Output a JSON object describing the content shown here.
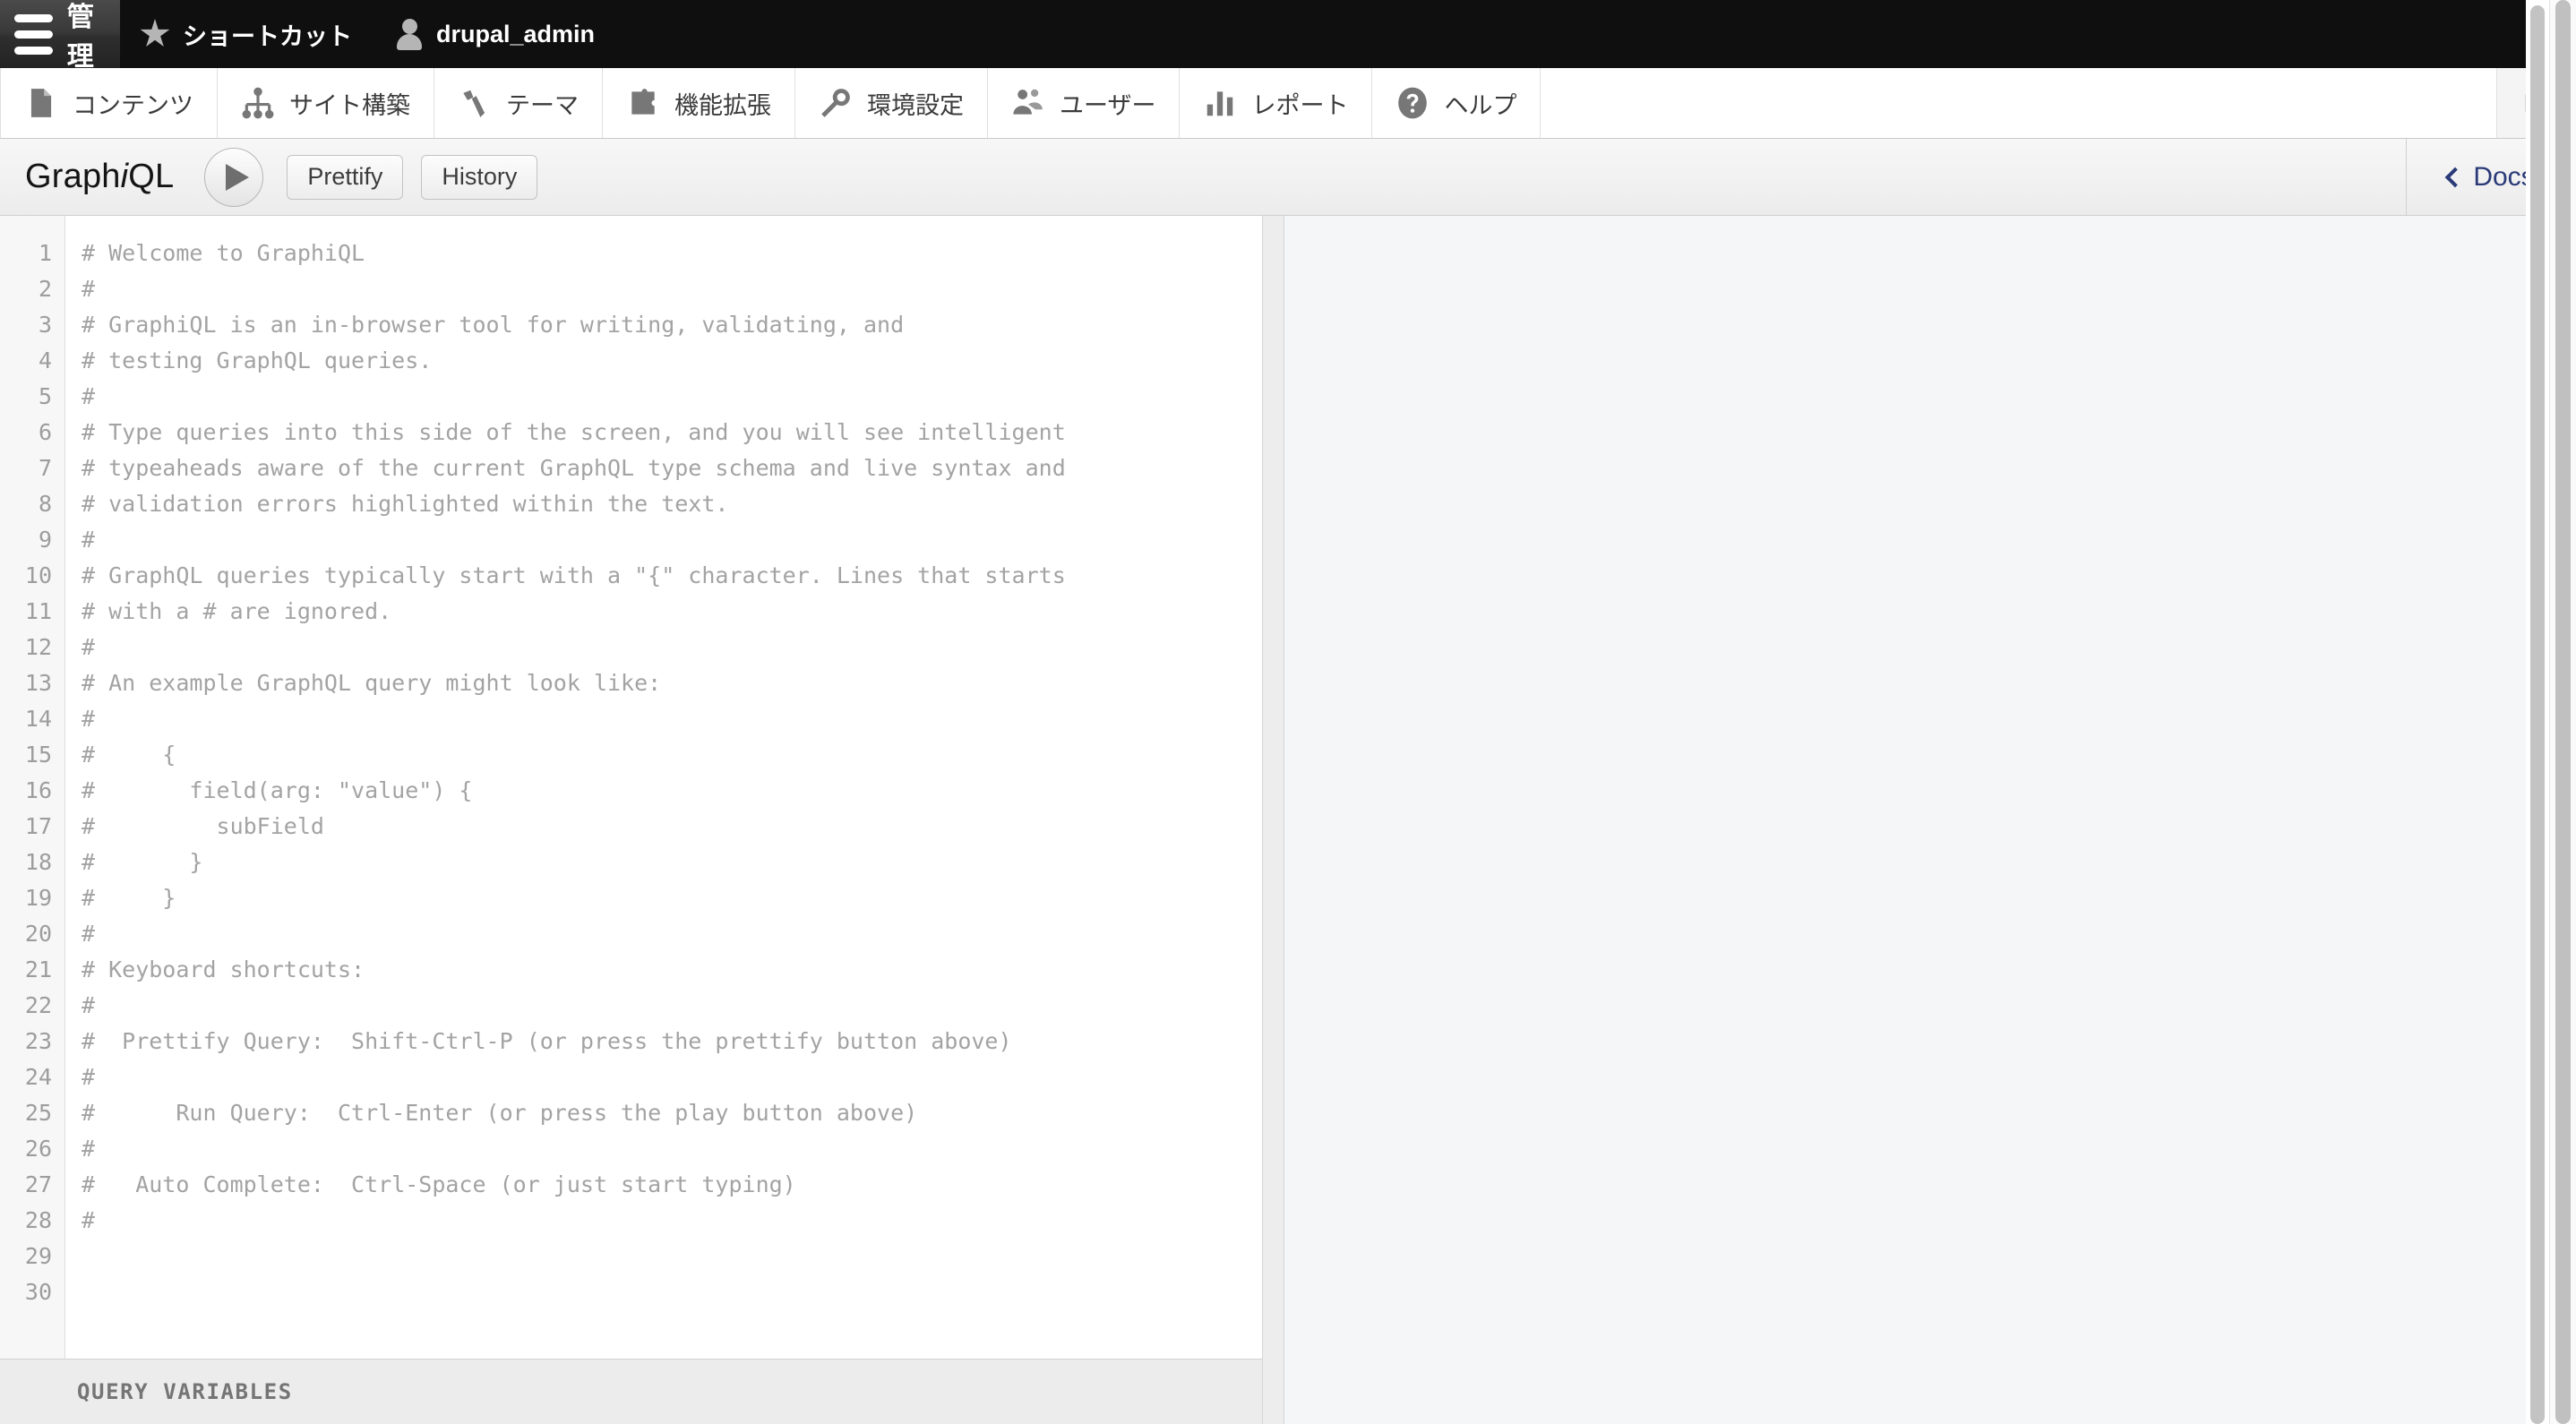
{
  "admin_bar": {
    "home_label": "管理",
    "home_icon": "hamburger-icon",
    "items": [
      {
        "icon": "star-icon",
        "label": "ショートカット"
      },
      {
        "icon": "person-icon",
        "label": "drupal_admin"
      }
    ]
  },
  "admin_menu": {
    "items": [
      {
        "icon": "content-page-icon",
        "label": "コンテンツ"
      },
      {
        "icon": "site-structure-icon",
        "label": "サイト構築"
      },
      {
        "icon": "theme-paint-icon",
        "label": "テーマ"
      },
      {
        "icon": "puzzle-extend-icon",
        "label": "機能拡張"
      },
      {
        "icon": "wrench-config-icon",
        "label": "環境設定"
      },
      {
        "icon": "users-icon",
        "label": "ユーザー"
      },
      {
        "icon": "bar-chart-reports-icon",
        "label": "レポート"
      },
      {
        "icon": "question-help-icon",
        "label": "ヘルプ"
      }
    ],
    "collapse_icon": "collapse-sidebar-icon"
  },
  "graphiql": {
    "logo_before": "Graph",
    "logo_italic": "i",
    "logo_after": "QL",
    "execute_icon": "play-icon",
    "prettify_label": "Prettify",
    "history_label": "History",
    "docs_label": "Docs",
    "docs_icon": "chevron-left-icon",
    "query_variables_label": "QUERY VARIABLES",
    "line_numbers": [
      "1",
      "2",
      "3",
      "4",
      "5",
      "6",
      "7",
      "8",
      "9",
      "10",
      "11",
      "12",
      "13",
      "14",
      "15",
      "16",
      "17",
      "18",
      "19",
      "20",
      "21",
      "22",
      "23",
      "24",
      "25",
      "26",
      "27",
      "28",
      "29",
      "30"
    ],
    "code_lines": [
      "# Welcome to GraphiQL",
      "#",
      "# GraphiQL is an in-browser tool for writing, validating, and",
      "# testing GraphQL queries.",
      "#",
      "# Type queries into this side of the screen, and you will see intelligent",
      "# typeaheads aware of the current GraphQL type schema and live syntax and",
      "# validation errors highlighted within the text.",
      "#",
      "# GraphQL queries typically start with a \"{\" character. Lines that starts",
      "# with a # are ignored.",
      "#",
      "# An example GraphQL query might look like:",
      "#",
      "#     {",
      "#       field(arg: \"value\") {",
      "#         subField",
      "#       }",
      "#     }",
      "#",
      "# Keyboard shortcuts:",
      "#",
      "#  Prettify Query:  Shift-Ctrl-P (or press the prettify button above)",
      "#",
      "#      Run Query:  Ctrl-Enter (or press the play button above)",
      "#",
      "#   Auto Complete:  Ctrl-Space (or just start typing)",
      "#",
      "",
      ""
    ]
  },
  "colors": {
    "admin_bar_bg": "#0f0f0f",
    "docs_link": "#2a3a78",
    "code_text": "#a3a3a3",
    "gutter_text": "#9d9d9d",
    "result_bg": "#f5f6f7"
  }
}
